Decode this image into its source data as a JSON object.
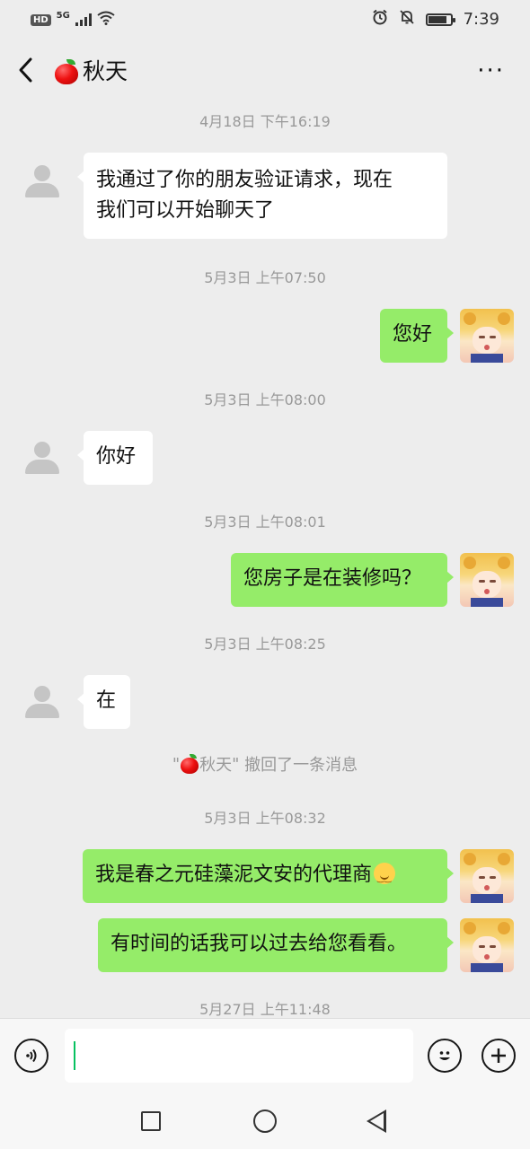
{
  "status_bar": {
    "hd": "HD",
    "network": "5G",
    "time": "7:39"
  },
  "header": {
    "title": "秋天",
    "title_icon": "red-apple-icon",
    "back_icon": "back-chevron-icon",
    "more_icon": "more-dots-icon",
    "more_label": "···"
  },
  "chat": {
    "timestamps": [
      "4月18日 下午16:19",
      "5月3日 上午07:50",
      "5月3日 上午08:00",
      "5月3日 上午08:01",
      "5月3日 上午08:25",
      "5月3日 上午08:32",
      "5月27日 上午11:48"
    ],
    "messages": [
      {
        "from": "them",
        "text_line1": "我通过了你的朋友验证请求，现在",
        "text_line2": "我们可以开始聊天了"
      },
      {
        "from": "me",
        "text": "您好"
      },
      {
        "from": "them",
        "text": "你好"
      },
      {
        "from": "me",
        "text": "您房子是在装修吗？"
      },
      {
        "from": "them",
        "text": "在"
      },
      {
        "from": "me",
        "text": "我是春之元硅藻泥文安的代理商",
        "emoji": "smile-emoji"
      },
      {
        "from": "me",
        "text": "有时间的话我可以过去给您看看。"
      }
    ],
    "recall": {
      "quote_open": "\"",
      "name": "秋天",
      "quote_close": "\"",
      "suffix": " 撤回了一条消息"
    }
  },
  "input_bar": {
    "voice_icon": "voice-icon",
    "emoji_icon": "emoji-icon",
    "plus_icon": "plus-icon",
    "text_value": ""
  },
  "nav_bar": {
    "icons": [
      "recents-square-icon",
      "home-circle-icon",
      "back-triangle-icon"
    ]
  },
  "colors": {
    "background": "#ededed",
    "bubble_out": "#95ec69",
    "bubble_in": "#ffffff",
    "timestamp": "#999999",
    "caret": "#07c160"
  }
}
